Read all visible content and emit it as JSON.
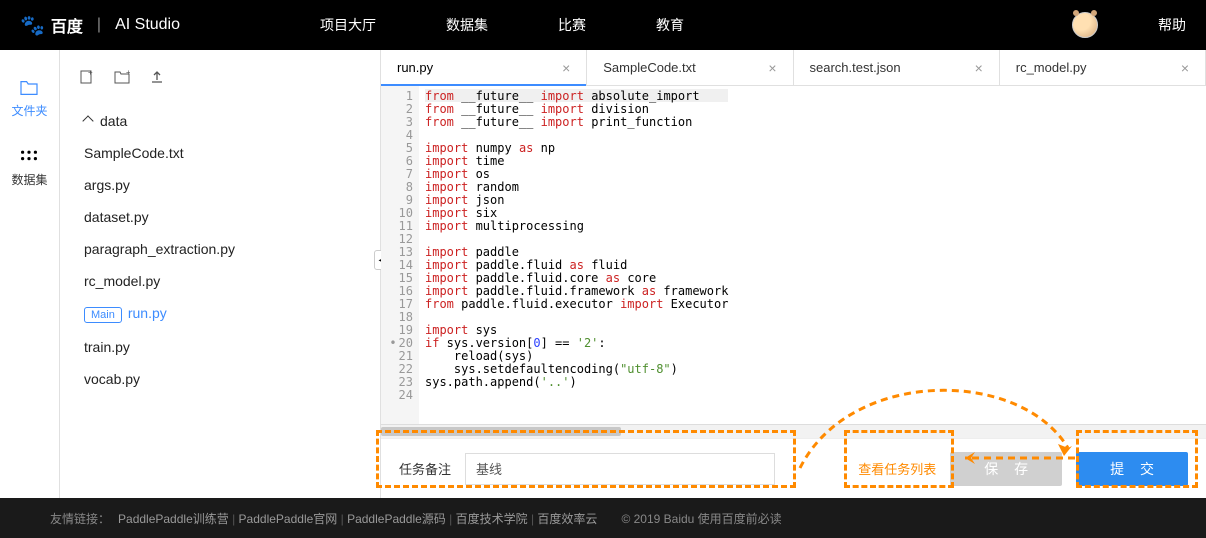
{
  "header": {
    "logo_text": "百度",
    "studio": "AI Studio",
    "nav": [
      "项目大厅",
      "数据集",
      "比赛",
      "教育"
    ],
    "help": "帮助"
  },
  "rail": {
    "files": "文件夹",
    "datasets": "数据集"
  },
  "toolbar_icons": {
    "new": "new-file-icon",
    "newfolder": "new-folder-icon",
    "upload": "upload-icon"
  },
  "tree": {
    "folder": "data",
    "files": [
      "SampleCode.txt",
      "args.py",
      "dataset.py",
      "paragraph_extraction.py",
      "rc_model.py",
      "run.py",
      "train.py",
      "vocab.py"
    ],
    "main_badge": "Main",
    "active": "run.py"
  },
  "tabs": [
    {
      "label": "run.py",
      "active": true
    },
    {
      "label": "SampleCode.txt"
    },
    {
      "label": "search.test.json"
    },
    {
      "label": "rc_model.py"
    }
  ],
  "code_lines": [
    {
      "n": 1,
      "html": "<span class='from'>from</span> __future__ <span class='imp'>import</span> absolute_import"
    },
    {
      "n": 2,
      "html": "<span class='from'>from</span> __future__ <span class='imp'>import</span> division"
    },
    {
      "n": 3,
      "html": "<span class='from'>from</span> __future__ <span class='imp'>import</span> print_function"
    },
    {
      "n": 4,
      "html": ""
    },
    {
      "n": 5,
      "html": "<span class='imp'>import</span> numpy <span class='as'>as</span> np"
    },
    {
      "n": 6,
      "html": "<span class='imp'>import</span> time"
    },
    {
      "n": 7,
      "html": "<span class='imp'>import</span> os"
    },
    {
      "n": 8,
      "html": "<span class='imp'>import</span> random"
    },
    {
      "n": 9,
      "html": "<span class='imp'>import</span> json"
    },
    {
      "n": 10,
      "html": "<span class='imp'>import</span> six"
    },
    {
      "n": 11,
      "html": "<span class='imp'>import</span> multiprocessing"
    },
    {
      "n": 12,
      "html": ""
    },
    {
      "n": 13,
      "html": "<span class='imp'>import</span> paddle"
    },
    {
      "n": 14,
      "html": "<span class='imp'>import</span> paddle.fluid <span class='as'>as</span> fluid"
    },
    {
      "n": 15,
      "html": "<span class='imp'>import</span> paddle.fluid.core <span class='as'>as</span> core"
    },
    {
      "n": 16,
      "html": "<span class='imp'>import</span> paddle.fluid.framework <span class='as'>as</span> framework"
    },
    {
      "n": 17,
      "html": "<span class='from'>from</span> paddle.fluid.executor <span class='imp'>import</span> Executor"
    },
    {
      "n": 18,
      "html": ""
    },
    {
      "n": 19,
      "html": "<span class='imp'>import</span> sys"
    },
    {
      "n": 20,
      "html": "<span class='if'>if</span> sys.version[<span class='num'>0</span>] == <span class='str'>'2'</span>:",
      "marked": true
    },
    {
      "n": 21,
      "html": "    reload(sys)"
    },
    {
      "n": 22,
      "html": "    sys.setdefaultencoding(<span class='str'>\"utf-8\"</span>)"
    },
    {
      "n": 23,
      "html": "sys.path.append(<span class='str'>'..'</span>)"
    },
    {
      "n": 24,
      "html": ""
    }
  ],
  "bottom": {
    "task_label": "任务备注",
    "task_value": "基线",
    "view_list": "查看任务列表",
    "save": "保 存",
    "submit": "提 交"
  },
  "footer": {
    "prefix": "友情链接：",
    "links": [
      "PaddlePaddle训练营",
      "PaddlePaddle官网",
      "PaddlePaddle源码",
      "百度技术学院",
      "百度效率云"
    ],
    "copyright": "© 2019 Baidu 使用百度前必读"
  }
}
